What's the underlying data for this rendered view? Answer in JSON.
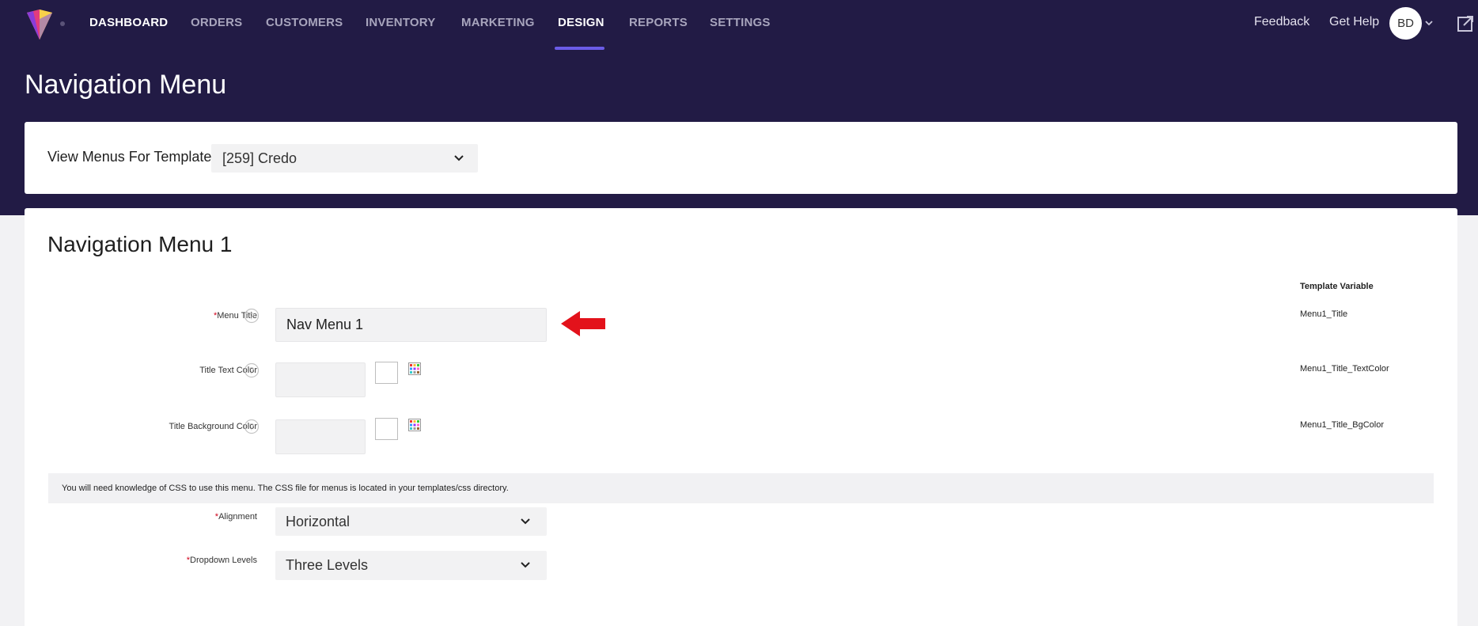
{
  "nav": {
    "items": [
      "DASHBOARD",
      "ORDERS",
      "CUSTOMERS",
      "INVENTORY",
      "MARKETING",
      "DESIGN",
      "REPORTS",
      "SETTINGS"
    ],
    "active": "DESIGN",
    "feedback": "Feedback",
    "get_help": "Get Help",
    "avatar_initials": "BD"
  },
  "page": {
    "title": "Navigation Menu"
  },
  "template_selector": {
    "label": "View Menus For Template",
    "selected": "[259] Credo"
  },
  "section": {
    "title": "Navigation Menu 1",
    "template_variable_header": "Template Variable",
    "required_mark": "*",
    "menu_title": {
      "label": "Menu Title",
      "value": "Nav Menu 1",
      "variable": "Menu1_Title"
    },
    "title_text_color": {
      "label": "Title Text Color",
      "value": "",
      "variable": "Menu1_Title_TextColor"
    },
    "title_bg_color": {
      "label": "Title Background Color",
      "value": "",
      "variable": "Menu1_Title_BgColor"
    },
    "info": "You will need knowledge of CSS to use this menu. The CSS file for menus is located in your templates/css directory.",
    "alignment": {
      "label": "Alignment",
      "selected": "Horizontal"
    },
    "dropdown_levels": {
      "label": "Dropdown Levels",
      "selected": "Three Levels"
    }
  },
  "colors": {
    "header_bg": "#221b45",
    "accent": "#6b5ce7",
    "arrow": "#e3121b"
  }
}
